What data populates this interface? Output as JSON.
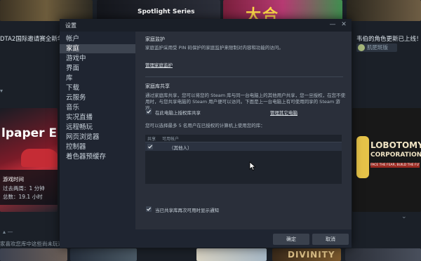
{
  "background": {
    "top_banner": "Spotlight Series",
    "top_art_text": "大合",
    "news_left": "DTA2国际邀请赛全新华",
    "news_right": "韦伯的角色更新已上线！",
    "news_source": "肌肥斑版",
    "game_tile": {
      "title": "lpaper Eng",
      "play_time_label": "游戏时间",
      "play_time_recent": "过去两周：1 分钟",
      "play_time_total": "总数：19.1 小时"
    },
    "lobotomy": {
      "title_line1": "LOBOTOMY",
      "title_line2": "CORPORATION",
      "tagline": "FACE THE FEAR, BUILD THE FUTURE"
    },
    "bottom_text": "家喜欢您库中这些尚未玩过的",
    "bottom_tile_text": "DIVINITY"
  },
  "dialog": {
    "title": "设置",
    "minimize": "—",
    "close": "✕"
  },
  "sidebar": {
    "items": [
      {
        "label": "帐户"
      },
      {
        "label": "家庭"
      },
      {
        "label": "游戏中"
      },
      {
        "label": "界面"
      },
      {
        "label": "库"
      },
      {
        "label": "下载"
      },
      {
        "label": "云服务"
      },
      {
        "label": "音乐"
      },
      {
        "label": "实况直播"
      },
      {
        "label": "远程畅玩"
      },
      {
        "label": "网页浏览器"
      },
      {
        "label": "控制器"
      },
      {
        "label": "着色器预缓存"
      }
    ],
    "active_index": 1
  },
  "family_monitor": {
    "heading": "家庭监护",
    "description": "家庭监护采用受 PIN 码保护的家庭监护来限制对内容和功能的访问。",
    "link": "管理家庭监护"
  },
  "library_sharing": {
    "heading": "家庭库共享",
    "description": "通过家庭库共享，您可以将您的 Steam 库与同一台电脑上的其他用户共享，您一旦授权，在您不使用时，与您共享电脑的 Steam 用户便可以访问。下面是上一台电脑上有可使用同享的 Steam 游戏。",
    "authorize_label": "在此电脑上授权库共享",
    "authorize_checked": true,
    "manage_link": "管理其它电脑",
    "limit_text": "您可以选择最多 5 名用户在已授权的计算机上使用您的库：",
    "columns": {
      "share": "共享",
      "user": "可用帐户"
    },
    "accounts": [
      {
        "checked": true,
        "name": "（其他人）"
      }
    ],
    "notify_label": "当已共享库再次可用时显示通知",
    "notify_checked": true
  },
  "footer": {
    "ok": "确定",
    "cancel": "取消"
  }
}
